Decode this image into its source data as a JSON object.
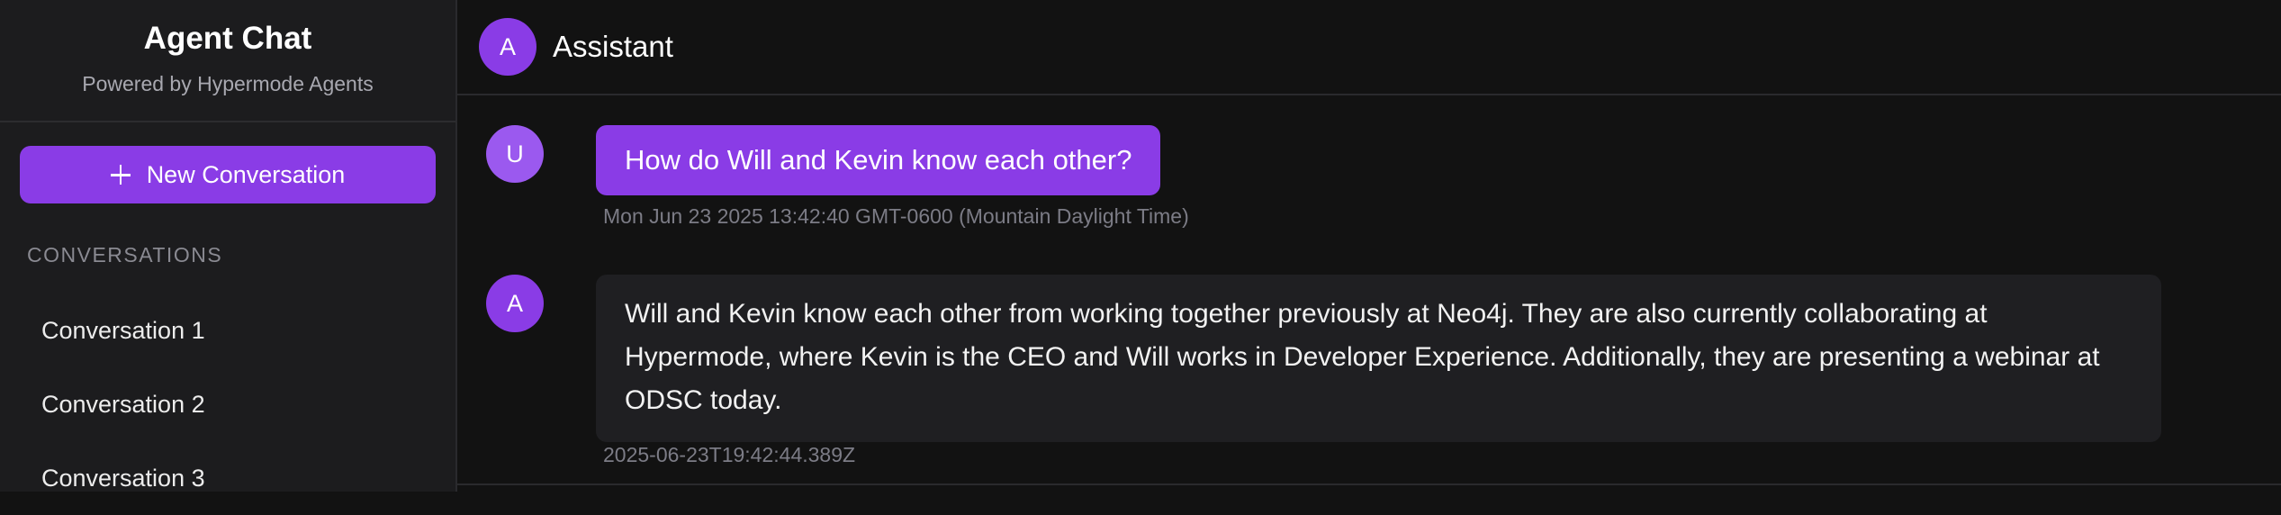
{
  "sidebar": {
    "title": "Agent Chat",
    "subtitle": "Powered by Hypermode Agents",
    "new_conversation_label": "New Conversation",
    "section_label": "CONVERSATIONS",
    "conversations": [
      {
        "label": "Conversation 1"
      },
      {
        "label": "Conversation 2"
      },
      {
        "label": "Conversation 3"
      }
    ]
  },
  "chat": {
    "header": {
      "avatar_letter": "A",
      "title": "Assistant"
    },
    "messages": [
      {
        "role": "user",
        "avatar_letter": "U",
        "text": "How do Will and Kevin know each other?",
        "timestamp": "Mon Jun 23 2025 13:42:40 GMT-0600 (Mountain Daylight Time)"
      },
      {
        "role": "assistant",
        "avatar_letter": "A",
        "text": "Will and Kevin know each other from working together previously at Neo4j. They are also currently collaborating at Hypermode, where Kevin is the CEO and Will works in Developer Experience. Additionally, they are presenting a webinar at ODSC today.",
        "timestamp": "2025-06-23T19:42:44.389Z"
      }
    ]
  },
  "colors": {
    "accent": "#8a3ce6",
    "background": "#121212",
    "sidebar": "#1c1c1e",
    "assistant_bubble": "#1f1f22"
  }
}
